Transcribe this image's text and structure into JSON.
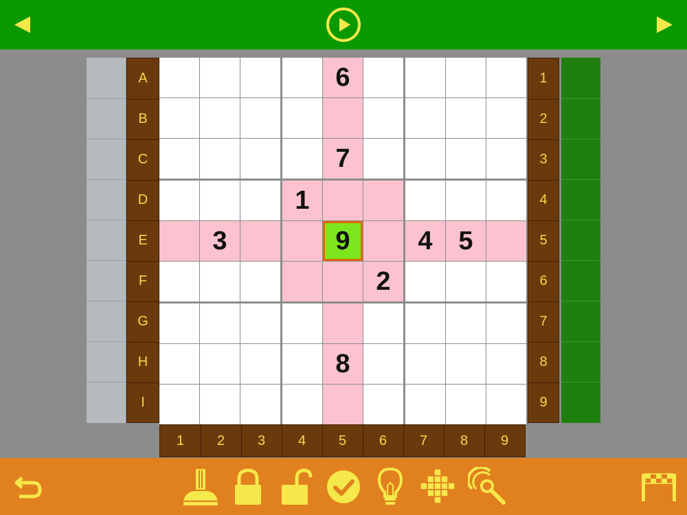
{
  "top_bar": {
    "prev_icon": "left-triangle-icon",
    "play_icon": "play-circle-icon",
    "next_icon": "right-triangle-icon",
    "icon_color": "#f5e84a"
  },
  "row_labels": [
    "A",
    "B",
    "C",
    "D",
    "E",
    "F",
    "G",
    "H",
    "I"
  ],
  "right_col_labels": [
    "1",
    "2",
    "3",
    "4",
    "5",
    "6",
    "7",
    "8",
    "9"
  ],
  "bottom_col_labels": [
    "1",
    "2",
    "3",
    "4",
    "5",
    "6",
    "7",
    "8",
    "9"
  ],
  "grid": [
    [
      "",
      "",
      "",
      "",
      "6",
      "",
      "",
      "",
      ""
    ],
    [
      "",
      "",
      "",
      "",
      "",
      "",
      "",
      "",
      ""
    ],
    [
      "",
      "",
      "",
      "",
      "7",
      "",
      "",
      "",
      ""
    ],
    [
      "",
      "",
      "",
      "1",
      "",
      "",
      "",
      "",
      ""
    ],
    [
      "",
      "3",
      "",
      "",
      "9",
      "",
      "4",
      "5",
      ""
    ],
    [
      "",
      "",
      "",
      "",
      "",
      "2",
      "",
      "",
      ""
    ],
    [
      "",
      "",
      "",
      "",
      "",
      "",
      "",
      "",
      ""
    ],
    [
      "",
      "",
      "",
      "",
      "8",
      "",
      "",
      "",
      ""
    ],
    [
      "",
      "",
      "",
      "",
      "",
      "",
      "",
      "",
      ""
    ]
  ],
  "selected_cell": {
    "row": 4,
    "col": 4
  },
  "colors": {
    "highlight": "#fbc3cf",
    "selected_fill": "#7ee61e",
    "selected_border": "#e0660e",
    "label_bg": "#6b3a0c",
    "label_text": "#f5d84a",
    "top_bar": "#0a9a00",
    "bottom_bar": "#e1801e"
  },
  "bottom_bar": {
    "tools": [
      "undo-icon",
      "eraser-icon",
      "lock-icon",
      "unlock-icon",
      "check-circle-icon",
      "lightbulb-icon",
      "grid-pattern-icon",
      "magnify-icon",
      "finish-flag-icon"
    ]
  }
}
